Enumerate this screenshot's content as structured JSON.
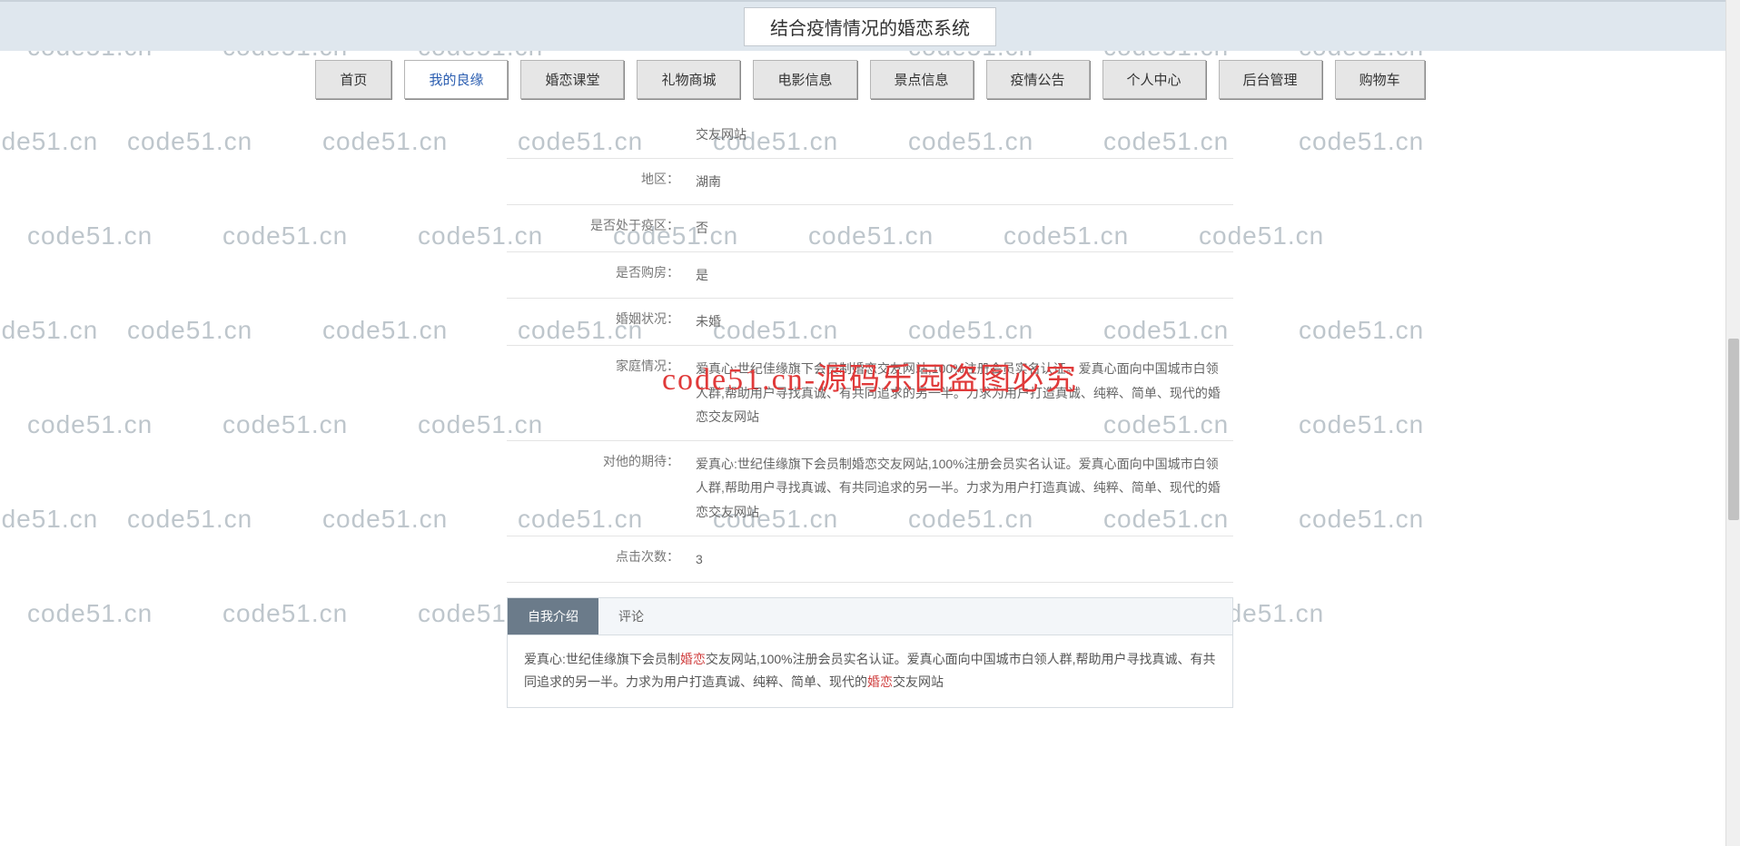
{
  "header": {
    "title": "结合疫情情况的婚恋系统"
  },
  "nav": {
    "items": [
      {
        "label": "首页"
      },
      {
        "label": "我的良缘"
      },
      {
        "label": "婚恋课堂"
      },
      {
        "label": "礼物商城"
      },
      {
        "label": "电影信息"
      },
      {
        "label": "景点信息"
      },
      {
        "label": "疫情公告"
      },
      {
        "label": "个人中心"
      },
      {
        "label": "后台管理"
      },
      {
        "label": "购物车"
      }
    ],
    "active_index": 1
  },
  "profile": {
    "rows": [
      {
        "label": "",
        "value": "交友网站"
      },
      {
        "label": "地区：",
        "value": "湖南"
      },
      {
        "label": "是否处于疫区：",
        "value": "否"
      },
      {
        "label": "是否购房：",
        "value": "是"
      },
      {
        "label": "婚姻状况：",
        "value": "未婚"
      },
      {
        "label": "家庭情况：",
        "value": "爱真心:世纪佳缘旗下会员制婚恋交友网站,100%注册会员实名认证。爱真心面向中国城市白领人群,帮助用户寻找真诚、有共同追求的另一半。力求为用户打造真诚、纯粹、简单、现代的婚恋交友网站"
      },
      {
        "label": "对他的期待：",
        "value": "爱真心:世纪佳缘旗下会员制婚恋交友网站,100%注册会员实名认证。爱真心面向中国城市白领人群,帮助用户寻找真诚、有共同追求的另一半。力求为用户打造真诚、纯粹、简单、现代的婚恋交友网站"
      },
      {
        "label": "点击次数：",
        "value": "3"
      }
    ]
  },
  "tabs": {
    "items": [
      {
        "label": "自我介绍"
      },
      {
        "label": "评论"
      }
    ],
    "active_index": 0,
    "body_prefix": "爱真心:世纪佳缘旗下会员制",
    "body_hl1": "婚恋",
    "body_mid": "交友网站,100%注册会员实名认证。爱真心面向中国城市白领人群,帮助用户寻找真诚、有共同追求的另一半。力求为用户打造真诚、纯粹、简单、现代的",
    "body_hl2": "婚恋",
    "body_suffix": "交友网站"
  },
  "overlay": {
    "text": "code51.cn-源码乐园盗图必究"
  },
  "watermark": {
    "text": "code51.cn"
  }
}
